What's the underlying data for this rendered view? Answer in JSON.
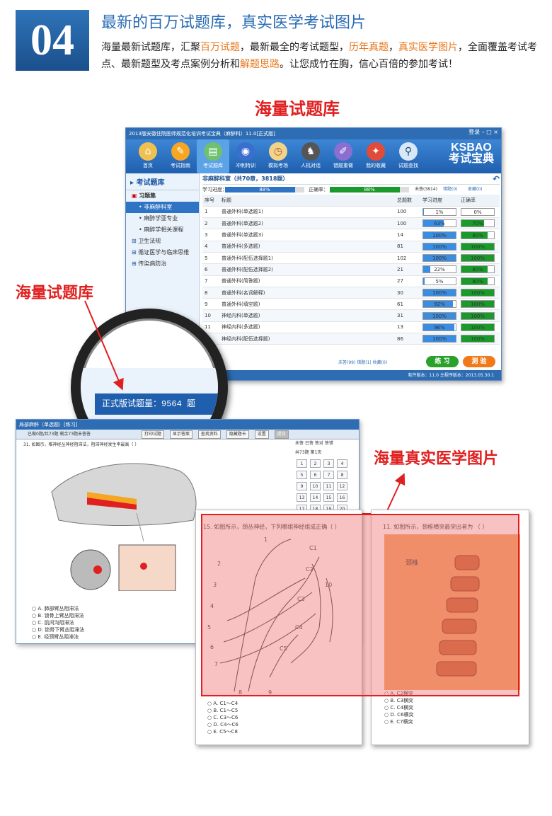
{
  "header": {
    "badge": "04",
    "title": "最新的百万试题库，真实医学考试图片",
    "intro_parts": [
      "海量最新试题库，汇聚",
      "百万试题",
      "，最新最全的考试题型，",
      "历年真题",
      "，",
      "真实医学图片",
      "，全面覆盖考试考点、最新题型及考点案例分析和",
      "解题思路",
      "。让您成竹在胸，信心百倍的参加考试！"
    ]
  },
  "labels": {
    "section1": "海量试题库",
    "side_label": "海量试题库",
    "section2": "海量真实医学图片"
  },
  "app": {
    "title": "2013版安徽住院医师规范化培训考试宝典（麻醉科）11.0[正式版]",
    "login": "登录",
    "brand": "KSBAO",
    "brand_cn": "考试宝典",
    "tools": [
      "首页",
      "考试指南",
      "考试题库",
      "冲刺特训",
      "模拟考场",
      "人机对话",
      "错题重做",
      "我的收藏",
      "试题查找"
    ],
    "sidebar": {
      "head": "考试题库",
      "group": "习题集",
      "subs": [
        "非麻醉科室",
        "麻醉学亚专业",
        "麻醉学相关课程"
      ],
      "items": [
        "卫生法规",
        "循证医学与临床思维",
        "传染病防治"
      ]
    },
    "main_title": "非麻醉科室（共70章，3818题）",
    "progress_label": "学习进度：",
    "progress_value": "88%",
    "accuracy_label": "正确率：",
    "accuracy_value": "88%",
    "stats": [
      "未答(3814)",
      "错题(0)",
      "收藏(0)"
    ],
    "columns": [
      "序号",
      "标题",
      "总题数",
      "学习进度",
      "正确率"
    ],
    "rows": [
      {
        "n": "1",
        "t": "普通外科(单选题1)",
        "c": "100",
        "p": 1,
        "pt": "1%",
        "a": 0,
        "at": "0%"
      },
      {
        "n": "2",
        "t": "普通外科(单选题2)",
        "c": "100",
        "p": 63,
        "pt": "63%",
        "a": 70,
        "at": "70%"
      },
      {
        "n": "3",
        "t": "普通外科(单选题3)",
        "c": "14",
        "p": 100,
        "pt": "100%",
        "a": 80,
        "at": "80%"
      },
      {
        "n": "4",
        "t": "普通外科(多选题)",
        "c": "81",
        "p": 100,
        "pt": "100%",
        "a": 100,
        "at": "100%"
      },
      {
        "n": "5",
        "t": "普通外科(配伍选择题1)",
        "c": "102",
        "p": 100,
        "pt": "100%",
        "a": 100,
        "at": "100%"
      },
      {
        "n": "6",
        "t": "普通外科(配伍选择题2)",
        "c": "21",
        "p": 22,
        "pt": "22%",
        "a": 80,
        "at": "80%"
      },
      {
        "n": "7",
        "t": "普通外科(简答题)",
        "c": "27",
        "p": 5,
        "pt": "5%",
        "a": 80,
        "at": "80%"
      },
      {
        "n": "8",
        "t": "普通外科(名词解释)",
        "c": "30",
        "p": 100,
        "pt": "100%",
        "a": 100,
        "at": "100%"
      },
      {
        "n": "9",
        "t": "普通外科(填空题)",
        "c": "61",
        "p": 92,
        "pt": "92%",
        "a": 100,
        "at": "100%"
      },
      {
        "n": "10",
        "t": "神经内科(单选题)",
        "c": "31",
        "p": 100,
        "pt": "100%",
        "a": 100,
        "at": "100%"
      },
      {
        "n": "11",
        "t": "神经内科(多选题)",
        "c": "13",
        "p": 96,
        "pt": "96%",
        "a": 100,
        "at": "100%"
      },
      {
        "n": "12",
        "t": "神经内科(配伍选择题)",
        "c": "86",
        "p": 100,
        "pt": "100%",
        "a": 100,
        "at": "100%"
      }
    ],
    "footer_stats": [
      "未答(99)",
      "错题(1)",
      "收藏(0)"
    ],
    "practice": "练 习",
    "test": "测 验",
    "version": "软件版本：11.0 主程序版本：2013.05.30.1",
    "magnifier_text": "正式版试题量：9564 题"
  },
  "win2": {
    "title": "局部麻醉（单选题）[练习]",
    "status": "已做0题/共73题   剩余73题未答答",
    "tools": [
      "打印试题",
      "显示答案",
      "查找资料",
      "隐藏题卡",
      "设置",
      "提交"
    ],
    "question": "31. 如图示，椎神经丛神经阻滞法，阻滞神经发生率最高（   ）",
    "options": [
      "A. 肺部臂丛阻滞法",
      "B. 锁骨上臂丛阻滞法",
      "C. 肌间沟阻滞法",
      "D. 锁骨下臂丛阻滞法",
      "E. 经颈臂丛阻滞法"
    ],
    "legend": [
      "未答",
      "已答",
      "答对",
      "答错"
    ],
    "page": "共73题  第1页",
    "grid": [
      "1",
      "2",
      "3",
      "4",
      "5",
      "6",
      "7",
      "8",
      "9",
      "10",
      "11",
      "12",
      "13",
      "14",
      "15",
      "16",
      "17",
      "18",
      "19",
      "20"
    ]
  },
  "sheet1": {
    "question": "15. 如图所示，颈丛神经，下列哪组神经组成正确（    ）",
    "labels": [
      "C1",
      "C2",
      "C3",
      "C4",
      "C5",
      "10",
      "8",
      "9",
      "1",
      "2",
      "3",
      "4",
      "5",
      "6",
      "7"
    ],
    "options": [
      "A. C1～C4",
      "B. C1～C5",
      "C. C3～C6",
      "D. C4～C6",
      "E. C5～C8"
    ]
  },
  "sheet2": {
    "question": "11. 如图所示，颈椎横突最突出者为  （    ）",
    "fig_label": "颈椎",
    "options": [
      "A. C2横突",
      "B. C3横突",
      "C. C4横突",
      "D. C6横突",
      "E. C7横突"
    ]
  }
}
